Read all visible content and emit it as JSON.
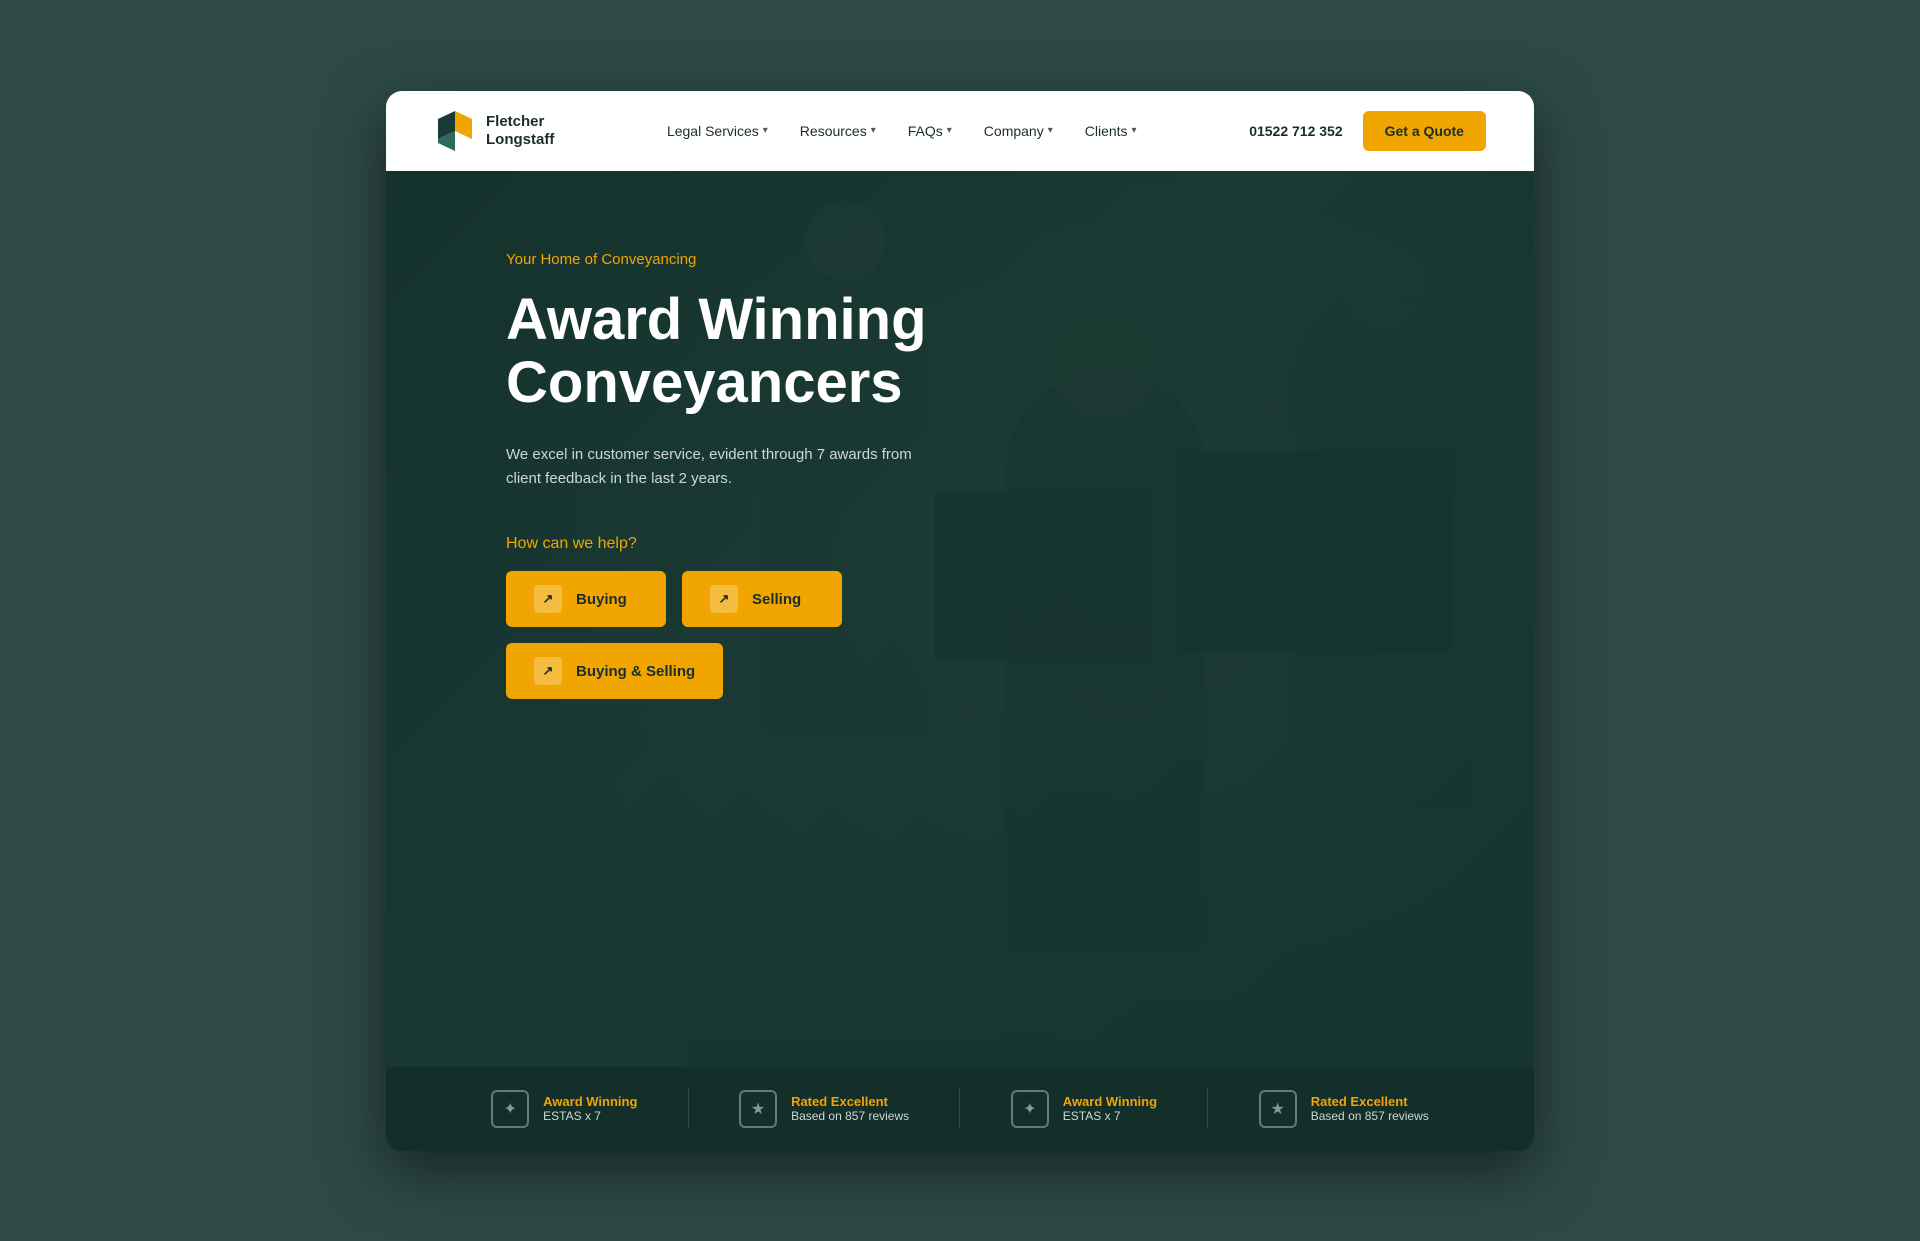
{
  "meta": {
    "title": "Fletcher Longstaff - Award Winning Conveyancers"
  },
  "navbar": {
    "logo": {
      "company_line1": "Fletcher",
      "company_line2": "Longstaff"
    },
    "nav_links": [
      {
        "label": "Legal Services",
        "has_dropdown": true
      },
      {
        "label": "Resources",
        "has_dropdown": true
      },
      {
        "label": "FAQs",
        "has_dropdown": true
      },
      {
        "label": "Company",
        "has_dropdown": true
      },
      {
        "label": "Clients",
        "has_dropdown": true
      }
    ],
    "phone": "01522 712 352",
    "cta_label": "Get a Quote"
  },
  "hero": {
    "tagline": "Your Home of Conveyancing",
    "title_line1": "Award Winning",
    "title_line2": "Conveyancers",
    "description": "We excel in customer service, evident through 7 awards from client feedback in the last 2 years.",
    "how_help_label": "How can we help?",
    "buttons": [
      {
        "label": "Buying"
      },
      {
        "label": "Selling"
      },
      {
        "label": "Buying & Selling"
      }
    ]
  },
  "stats": [
    {
      "title": "Award Winning",
      "subtitle": "ESTAS x 7"
    },
    {
      "title": "Rated  Excellent",
      "subtitle": "Based on 857 reviews"
    },
    {
      "title": "Award Winning",
      "subtitle": "ESTAS x 7"
    },
    {
      "title": "Rated  Excellent",
      "subtitle": "Based on 857 reviews"
    }
  ],
  "colors": {
    "accent": "#f0a500",
    "dark_bg": "#2d4a47",
    "hero_bg": "#1e3a38",
    "white": "#ffffff",
    "text_light": "#ccd8d5"
  }
}
